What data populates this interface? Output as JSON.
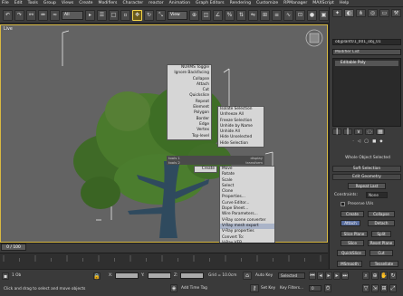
{
  "menu": [
    "File",
    "Edit",
    "Tools",
    "Group",
    "Views",
    "Create",
    "Modifiers",
    "Character",
    "reactor",
    "Animation",
    "Graph Editors",
    "Rendering",
    "Customize",
    "RPManager",
    "MAXScript",
    "Help"
  ],
  "toolbar": {
    "selection_filter": "All",
    "view_dropdown": "View"
  },
  "viewport": {
    "label": "Live"
  },
  "quad_menu": {
    "top_left": [
      "NURMS Toggle",
      "Ignore Backfacing",
      "Collapse",
      "Attach",
      "Cut",
      "Quickslice",
      "Repeat",
      "Element",
      "Polygon",
      "Border",
      "Edge",
      "Vertex",
      "Top-level"
    ],
    "top_right": [
      "Isolate Selection",
      "Unfreeze All",
      "Freeze Selection",
      "Unhide by Name",
      "Unhide All",
      "Hide Unselected",
      "Hide Selection"
    ],
    "header_left_1": "tools 1",
    "header_right_1": "display",
    "header_left_2": "tools 2",
    "header_right_2": "transform",
    "bottom_left": [
      "Create"
    ],
    "bottom_right": [
      "Move",
      "Rotate",
      "Scale",
      "Select",
      "Clone",
      "Properties...",
      "Curve Editor...",
      "Dope Sheet...",
      "Wire Parameters...",
      "V-Ray scene converter",
      "V-Ray mesh export",
      "V-Ray properties",
      "Convert To:",
      "V-Ray VFB"
    ]
  },
  "right_panel": {
    "object_name": "objplant01_001_obj_01",
    "modifier_list": "Modifier List",
    "stack_item": "Editable Poly",
    "whole_object": "Whole Object Selected",
    "soft_selection": "Soft Selection",
    "edit_geometry": "Edit Geometry",
    "repeat_last": "Repeat Last",
    "constraints_label": "Constraints:",
    "constraints_value": "None",
    "preserve_uvs": "Preserve UVs",
    "create_btn": "Create",
    "collapse_btn": "Collapse",
    "attach_btn": "Attach",
    "detach_btn": "Detach",
    "slice_plane_btn": "Slice Plane",
    "split_btn": "Split",
    "slice_btn": "Slice",
    "reset_plane_btn": "Reset Plane",
    "quickslice_btn": "QuickSlice",
    "cut_btn": "Cut",
    "msmooth_btn": "MSmooth",
    "tessellate_btn": "Tessellate"
  },
  "timeline": {
    "slider": "0 / 100"
  },
  "status": {
    "object_count": "1 Ob",
    "x_label": "X:",
    "y_label": "Y:",
    "z_label": "Z:",
    "grid": "Grid = 10.0cm",
    "auto_key": "Auto Key",
    "selected": "Selected",
    "set_key": "Set Key",
    "key_filters": "Key Filters...",
    "frame": "0",
    "prompt": "Click and drag to select and move objects",
    "add_time_tag": "Add Time Tag",
    "accent_color": "#d8b941"
  }
}
